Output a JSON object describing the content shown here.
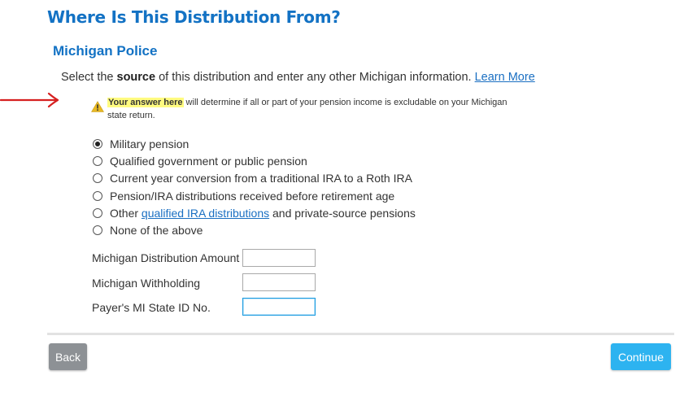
{
  "header": {
    "title": "Where Is This Distribution From?"
  },
  "section": {
    "title": "Michigan Police"
  },
  "instructions": {
    "before": "Select the ",
    "bold": "source",
    "after": " of this distribution and enter any other Michigan information. ",
    "link": "Learn More"
  },
  "warning": {
    "highlight": "Your answer here",
    "text": " will determine if all or part of your pension income is excludable on your Michigan state return.",
    "icon": "warning-triangle-icon",
    "icon_color": "#e8b923",
    "highlight_color": "#fffb80"
  },
  "annotation": {
    "arrow_color": "#d62020"
  },
  "options": {
    "opt1": "Military pension",
    "opt2": "Qualified government or public pension",
    "opt3": "Current year conversion from a traditional IRA to a Roth IRA",
    "opt4": "Pension/IRA distributions received before retirement age",
    "opt5_prefix": "Other ",
    "opt5_link": "qualified IRA distributions",
    "opt5_suffix": " and private-source pensions",
    "opt6": "None of the above",
    "selected": "Military pension"
  },
  "fields": {
    "amount_label": "Michigan Distribution Amount",
    "amount_value": "",
    "withholding_label": "Michigan Withholding",
    "withholding_value": "",
    "payer_id_label": "Payer's MI State ID No.",
    "payer_id_value": ""
  },
  "buttons": {
    "back": "Back",
    "continue": "Continue"
  },
  "colors": {
    "heading": "#1372c4",
    "link": "#1a6fc2",
    "continue": "#2db3f0",
    "back": "#8d9195"
  }
}
